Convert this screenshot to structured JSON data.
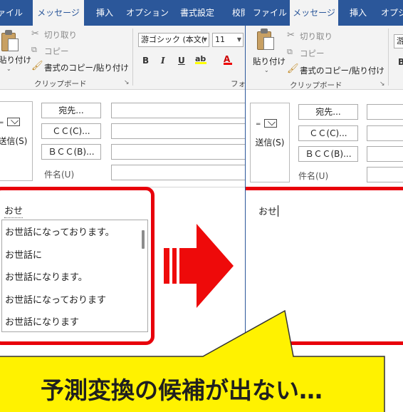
{
  "left_window": {
    "tabs": [
      "ファイル",
      "メッセージ",
      "挿入",
      "オプション",
      "書式設定",
      "校閲"
    ],
    "active_tab": 1,
    "ribbon": {
      "paste_label": "貼り付け",
      "cut_label": "切り取り",
      "copy_label": "コピー",
      "format_painter_label": "書式のコピー/貼り付け",
      "clipboard_group": "クリップボード",
      "font_name": "游ゴシック (本文(",
      "font_size": "11",
      "bold": "B",
      "italic": "I",
      "underline": "U",
      "font_group": "フォ"
    },
    "compose": {
      "send_label": "送信(S)",
      "to_button": "宛先...",
      "cc_button": "ＣＣ(C)...",
      "bcc_button": "ＢＣＣ(B)...",
      "subject_label": "件名(U)"
    },
    "body": {
      "typed": "おせ",
      "candidates": [
        "お世話になっております。",
        "お世話に",
        "お世話になります。",
        "お世話になっております",
        "お世話になります"
      ]
    }
  },
  "right_window": {
    "tabs": [
      "ファイル",
      "メッセージ",
      "挿入",
      "オプシ"
    ],
    "active_tab": 1,
    "ribbon": {
      "paste_label": "貼り付け",
      "cut_label": "切り取り",
      "copy_label": "コピー",
      "format_painter_label": "書式のコピー/貼り付け",
      "clipboard_group": "クリップボード",
      "font_name_partial": "游",
      "bold": "B"
    },
    "compose": {
      "send_label": "送信(S)",
      "to_button": "宛先...",
      "cc_button": "ＣＣ(C)...",
      "bcc_button": "ＢＣＣ(B)...",
      "subject_label": "件名(U)"
    },
    "body": {
      "typed": "おせ"
    }
  },
  "callout": {
    "text": "予測変換の候補が出ない…",
    "fill": "#fff200"
  },
  "colors": {
    "tab_bar": "#2b579a",
    "highlight_red": "#e8000b",
    "ribbon_bg": "#f3f3f3"
  }
}
